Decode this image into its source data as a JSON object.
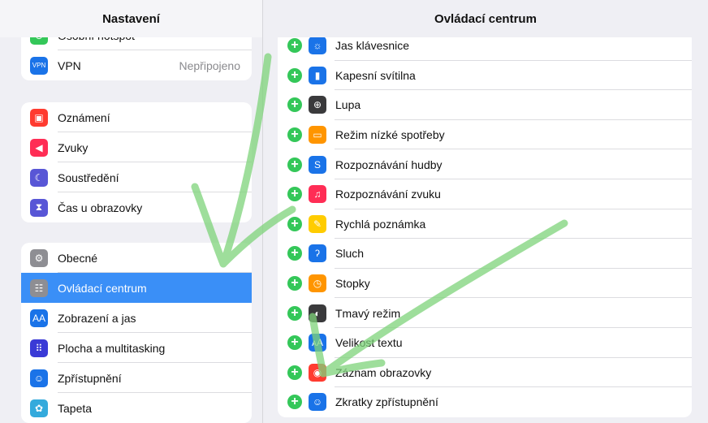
{
  "left": {
    "title": "Nastavení",
    "group1": [
      {
        "name": "sidebar-item-hotspot",
        "label": "Osobní hotspot",
        "icon": "hotspot-icon",
        "color": "#34c759",
        "glyph": "⊚"
      },
      {
        "name": "sidebar-item-vpn",
        "label": "VPN",
        "value": "Nepřipojeno",
        "icon": "vpn-icon",
        "color": "#1a73e8",
        "glyph": "VPN"
      }
    ],
    "group2": [
      {
        "name": "sidebar-item-notifications",
        "label": "Oznámení",
        "icon": "notifications-icon",
        "color": "#ff3b30",
        "glyph": "▣"
      },
      {
        "name": "sidebar-item-sounds",
        "label": "Zvuky",
        "icon": "speaker-icon",
        "color": "#ff2d55",
        "glyph": "◀"
      },
      {
        "name": "sidebar-item-focus",
        "label": "Soustředění",
        "icon": "moon-icon",
        "color": "#5856d6",
        "glyph": "☾"
      },
      {
        "name": "sidebar-item-screen-time",
        "label": "Čas u obrazovky",
        "icon": "hourglass-icon",
        "color": "#5856d6",
        "glyph": "⧗"
      }
    ],
    "group3": [
      {
        "name": "sidebar-item-general",
        "label": "Obecné",
        "icon": "gear-icon",
        "color": "#8e8e93",
        "glyph": "⚙"
      },
      {
        "name": "sidebar-item-control-center",
        "label": "Ovládací centrum",
        "icon": "switches-icon",
        "color": "#8e8e93",
        "glyph": "☷",
        "selected": true
      },
      {
        "name": "sidebar-item-display",
        "label": "Zobrazení a jas",
        "icon": "text-size-icon",
        "color": "#1a73e8",
        "glyph": "AA"
      },
      {
        "name": "sidebar-item-home-screen",
        "label": "Plocha a multitasking",
        "icon": "grid-icon",
        "color": "#3a3ad6",
        "glyph": "⠿"
      },
      {
        "name": "sidebar-item-accessibility",
        "label": "Zpřístupnění",
        "icon": "accessibility-icon",
        "color": "#1a73e8",
        "glyph": "☺"
      },
      {
        "name": "sidebar-item-wallpaper",
        "label": "Tapeta",
        "icon": "flower-icon",
        "color": "#34aadc",
        "glyph": "✿"
      }
    ]
  },
  "right": {
    "title": "Ovládací centrum",
    "items": [
      {
        "label": "Jas klávesnice",
        "icon": "keyboard-brightness-icon",
        "color": "#1a73e8",
        "glyph": "☼"
      },
      {
        "label": "Kapesní svítilna",
        "icon": "flashlight-icon",
        "color": "#1a73e8",
        "glyph": "▮"
      },
      {
        "label": "Lupa",
        "icon": "magnifier-icon",
        "color": "#3a3a3c",
        "glyph": "⊕"
      },
      {
        "label": "Režim nízké spotřeby",
        "icon": "battery-icon",
        "color": "#ff9500",
        "glyph": "▭"
      },
      {
        "label": "Rozpoznávání hudby",
        "icon": "shazam-icon",
        "color": "#1a73e8",
        "glyph": "S"
      },
      {
        "label": "Rozpoznávání zvuku",
        "icon": "sound-recognition-icon",
        "color": "#ff2d55",
        "glyph": "♫"
      },
      {
        "label": "Rychlá poznámka",
        "icon": "quick-note-icon",
        "color": "#ffcc00",
        "glyph": "✎"
      },
      {
        "label": "Sluch",
        "icon": "ear-icon",
        "color": "#1a73e8",
        "glyph": "ʔ"
      },
      {
        "label": "Stopky",
        "icon": "stopwatch-icon",
        "color": "#ff9500",
        "glyph": "◷"
      },
      {
        "label": "Tmavý režim",
        "icon": "dark-mode-icon",
        "color": "#3a3a3c",
        "glyph": "◐"
      },
      {
        "label": "Velikost textu",
        "icon": "text-size-icon",
        "color": "#1a73e8",
        "glyph": "ᴀA"
      },
      {
        "label": "Záznam obrazovky",
        "icon": "screen-record-icon",
        "color": "#ff3b30",
        "glyph": "◉"
      },
      {
        "label": "Zkratky zpřístupnění",
        "icon": "accessibility-icon",
        "color": "#1a73e8",
        "glyph": "☺"
      }
    ]
  },
  "colors": {
    "selected": "#3a8ff7",
    "annotation": "#7ed37a"
  }
}
